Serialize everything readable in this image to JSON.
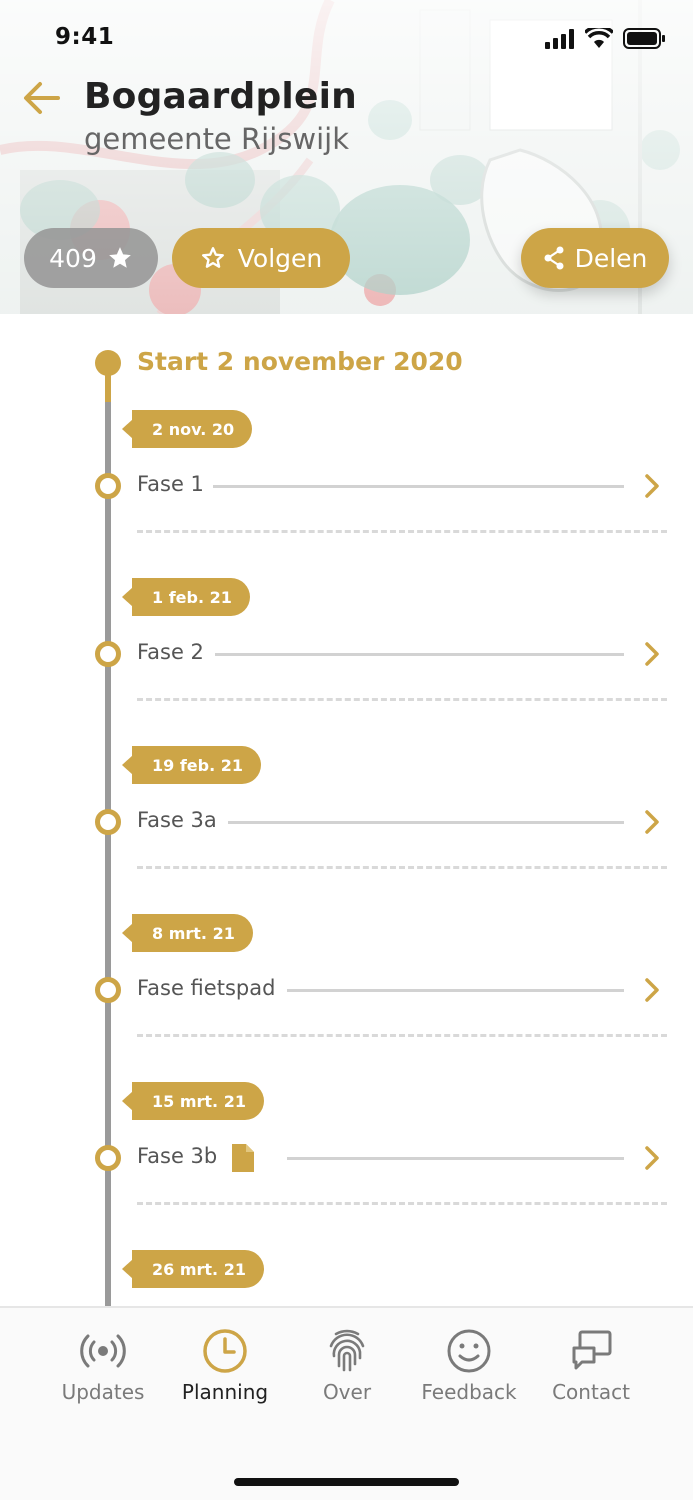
{
  "status_bar": {
    "time": "9:41"
  },
  "header": {
    "title": "Bogaardplein",
    "subtitle": "gemeente Rijswijk",
    "rating_count": "409",
    "follow_label": "Volgen",
    "share_label": "Delen",
    "accent_color": "#cda547"
  },
  "timeline": {
    "start_label": "Start 2 november 2020",
    "phases": [
      {
        "date": "2 nov. 20",
        "name": "Fase 1",
        "has_document": false
      },
      {
        "date": "1 feb. 21",
        "name": "Fase 2",
        "has_document": false
      },
      {
        "date": "19 feb. 21",
        "name": "Fase 3a",
        "has_document": false
      },
      {
        "date": "8 mrt. 21",
        "name": "Fase fietspad",
        "has_document": false
      },
      {
        "date": "15 mrt. 21",
        "name": "Fase 3b",
        "has_document": true
      },
      {
        "date": "26 mrt. 21"
      }
    ]
  },
  "tabbar": {
    "tabs": [
      {
        "label": "Updates",
        "icon": "broadcast-icon",
        "active": false
      },
      {
        "label": "Planning",
        "icon": "clock-icon",
        "active": true
      },
      {
        "label": "Over",
        "icon": "fingerprint-icon",
        "active": false
      },
      {
        "label": "Feedback",
        "icon": "smiley-icon",
        "active": false
      },
      {
        "label": "Contact",
        "icon": "chat-screen-icon",
        "active": false
      }
    ]
  }
}
